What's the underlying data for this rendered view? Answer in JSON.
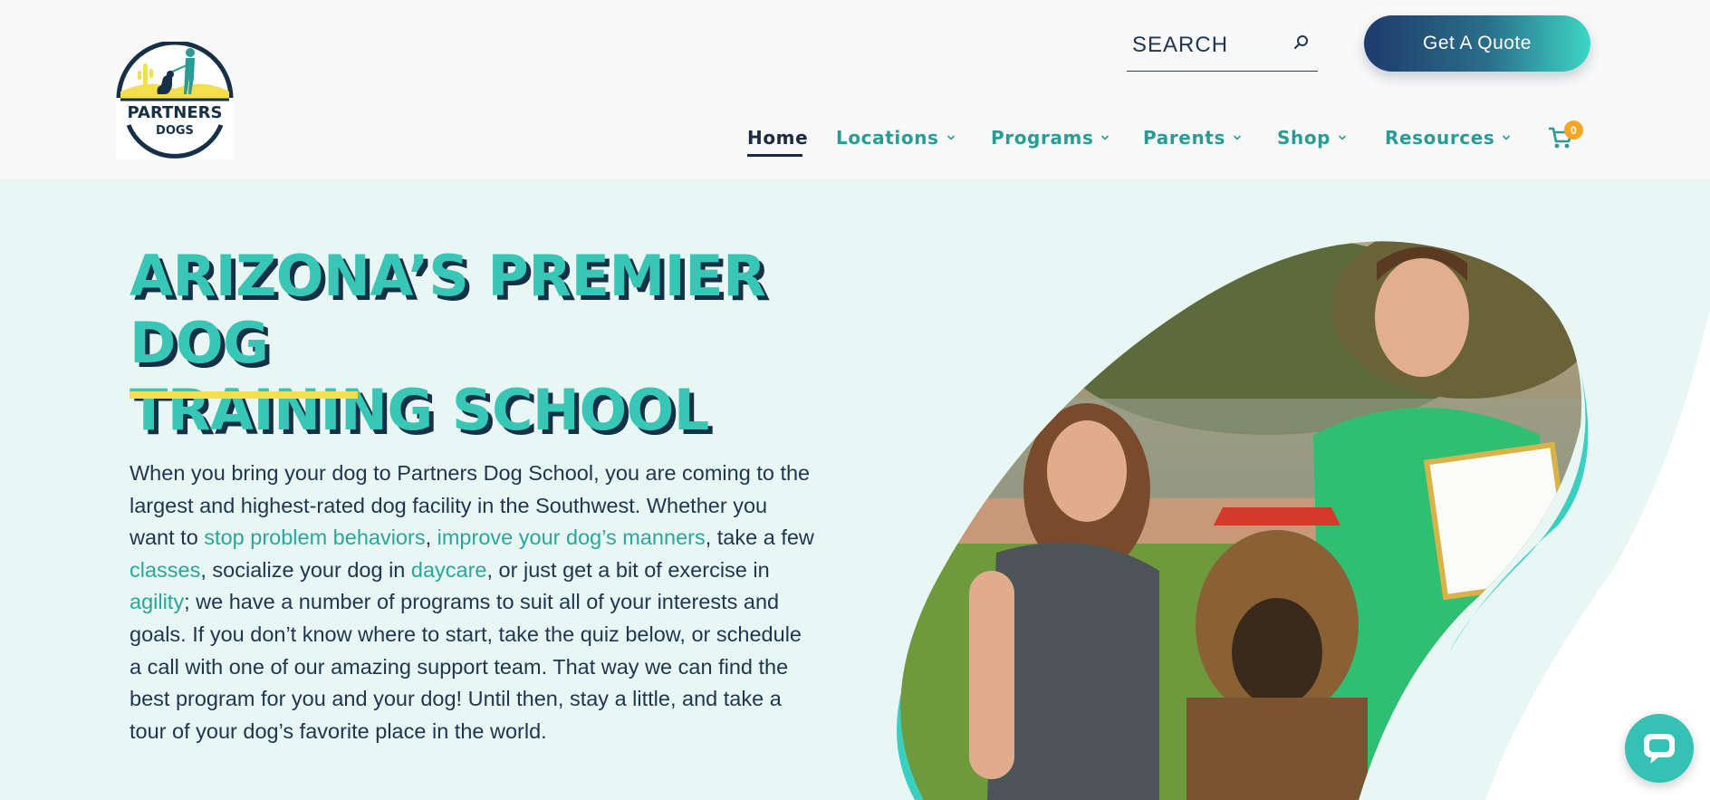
{
  "brand": {
    "logo_line1": "PARTNERS",
    "logo_line2": "DOGS",
    "colors": {
      "teal": "#38c6b6",
      "navy": "#163048",
      "yellow": "#f5de4c",
      "orange": "#f6a623"
    }
  },
  "header": {
    "search": {
      "label": "SEARCH",
      "icon": "search-icon"
    },
    "quote_button": "Get A Quote",
    "nav": [
      {
        "label": "Home",
        "active": true,
        "has_dropdown": false
      },
      {
        "label": "Locations",
        "active": false,
        "has_dropdown": true
      },
      {
        "label": "Programs",
        "active": false,
        "has_dropdown": true
      },
      {
        "label": "Parents",
        "active": false,
        "has_dropdown": true
      },
      {
        "label": "Shop",
        "active": false,
        "has_dropdown": true
      },
      {
        "label": "Resources",
        "active": false,
        "has_dropdown": true
      }
    ],
    "cart": {
      "icon": "cart-icon",
      "count": "0"
    }
  },
  "hero": {
    "title_line1": "ARIZONA’S PREMIER DOG",
    "title_line2": "TRAINING SCHOOL",
    "intro": {
      "p1": "When you bring your dog to Partners Dog School, you are coming to the largest and highest-rated dog facility in the Southwest. Whether you want to ",
      "link1": "stop problem behaviors",
      "p2": ", ",
      "link2": "improve your dog’s manners",
      "p3": ", take a few ",
      "link3": "classes",
      "p4": ", socialize your dog in ",
      "link4": "daycare",
      "p5": ", or just get a bit of exercise in ",
      "link5": "agility",
      "p6": "; we have a number of programs to suit all of your interests and goals. If you don’t know where to start, take the quiz below, or schedule a call with one of our amazing support team. That way we can find the best program for you and your dog! Until then, stay a little, and take a tour of your dog’s favorite place in the world."
    },
    "photo_alt_certificate": "Partners Dog Training"
  },
  "chat": {
    "icon": "chat-bubble-icon"
  }
}
